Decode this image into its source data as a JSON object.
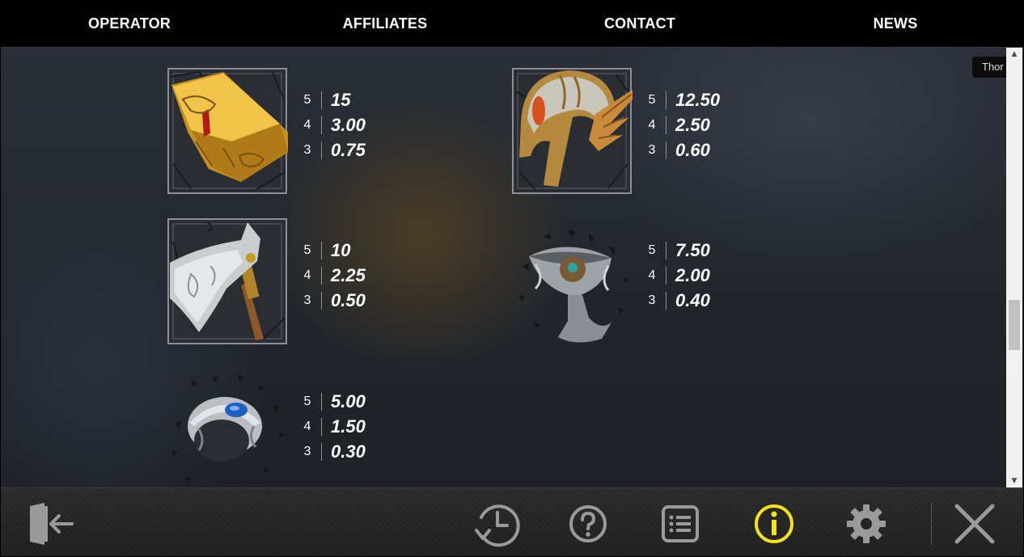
{
  "nav": {
    "items": [
      "OPERATOR",
      "AFFILIATES",
      "CONTACT",
      "NEWS"
    ]
  },
  "tooltip": "Thor",
  "paytable": {
    "symbols": [
      {
        "icon": "mjolnir-hammer-icon",
        "payouts": [
          {
            "count": "5",
            "value": "15"
          },
          {
            "count": "4",
            "value": "3.00"
          },
          {
            "count": "3",
            "value": "0.75"
          }
        ]
      },
      {
        "icon": "winged-helmet-icon",
        "payouts": [
          {
            "count": "5",
            "value": "12.50"
          },
          {
            "count": "4",
            "value": "2.50"
          },
          {
            "count": "3",
            "value": "0.60"
          }
        ]
      },
      {
        "icon": "battle-axe-icon",
        "payouts": [
          {
            "count": "5",
            "value": "10"
          },
          {
            "count": "4",
            "value": "2.25"
          },
          {
            "count": "3",
            "value": "0.50"
          }
        ]
      },
      {
        "icon": "chalice-icon",
        "payouts": [
          {
            "count": "5",
            "value": "7.50"
          },
          {
            "count": "4",
            "value": "2.00"
          },
          {
            "count": "3",
            "value": "0.40"
          }
        ]
      },
      {
        "icon": "ring-icon",
        "payouts": [
          {
            "count": "5",
            "value": "5.00"
          },
          {
            "count": "4",
            "value": "1.50"
          },
          {
            "count": "3",
            "value": "0.30"
          }
        ]
      }
    ]
  },
  "toolbar": {
    "buttons": [
      "exit-icon",
      "history-icon",
      "help-icon",
      "paytable-list-icon",
      "info-icon",
      "settings-gear-icon",
      "close-icon"
    ],
    "active": "info-icon",
    "colors": {
      "active": "#f5e21a",
      "inactive": "#9a9a9a"
    }
  }
}
